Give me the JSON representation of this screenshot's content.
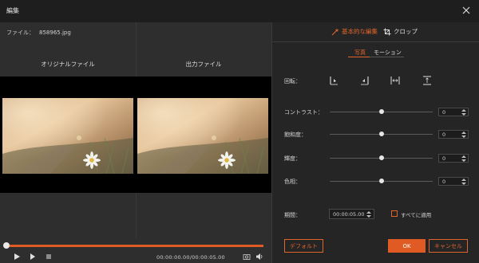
{
  "window": {
    "title": "編集"
  },
  "preview": {
    "file_label": "ファイル：",
    "file_name": "858965.jpg",
    "original_label": "オリジナルファイル",
    "output_label": "出力ファイル"
  },
  "playback": {
    "time": "00:00:00.00/00:00:05.00",
    "progress": 1.0
  },
  "tabs": {
    "basic_edit": "基本的な編集",
    "crop": "クロップ"
  },
  "subtabs": {
    "photo": "写真",
    "motion": "モーション"
  },
  "rotate": {
    "label": "回転："
  },
  "adjustments": [
    {
      "label": "コントラスト：",
      "value": "0",
      "level": 0.5
    },
    {
      "label": "飽和度：",
      "value": "0",
      "level": 0.5
    },
    {
      "label": "輝度：",
      "value": "0",
      "level": 0.5
    },
    {
      "label": "色相：",
      "value": "0",
      "level": 0.5
    }
  ],
  "duration": {
    "label": "期間：",
    "value": "00:00:05.00",
    "apply_all_label": "すべてに適用"
  },
  "buttons": {
    "default": "デフォルト",
    "ok": "OK",
    "cancel": "キャンセル"
  },
  "colors": {
    "accent": "#e05a24",
    "panel": "#252525",
    "preview_bg": "#2e2e2e"
  },
  "icons": [
    "close-icon",
    "play-icon",
    "next-frame-icon",
    "stop-icon",
    "snapshot-icon",
    "volume-icon",
    "magic-wand-icon",
    "crop-icon",
    "rotate-right-icon",
    "rotate-left-icon",
    "flip-horizontal-icon",
    "flip-vertical-icon"
  ]
}
